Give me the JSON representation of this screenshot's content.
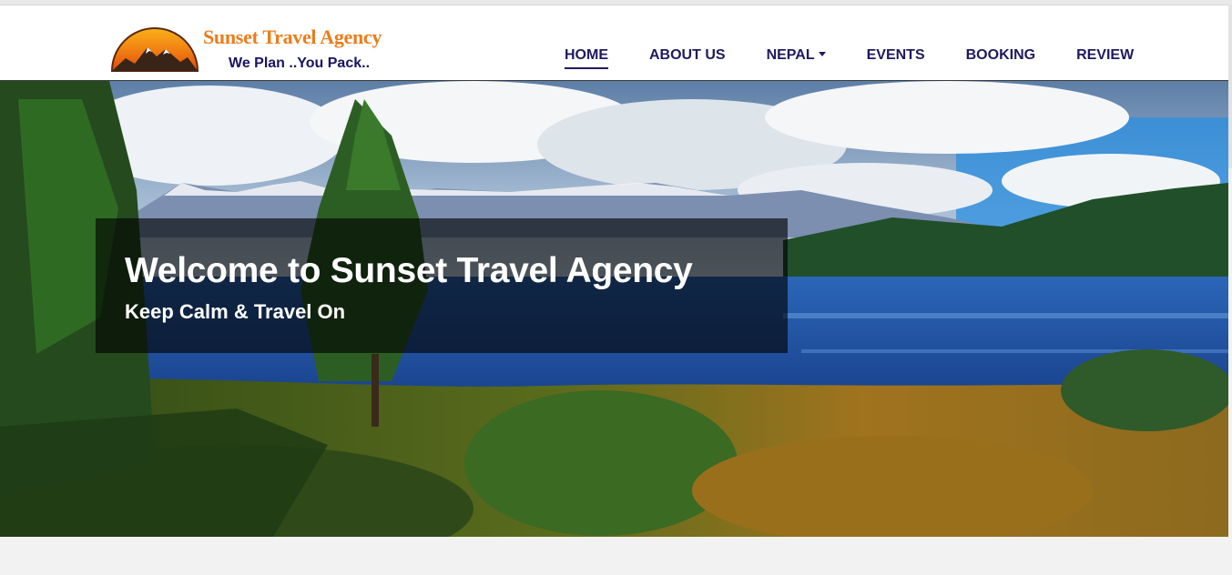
{
  "brand": {
    "name": "Sunset Travel Agency",
    "tagline": "We Plan ..You Pack..",
    "logo_icon": "sunset-mountain-logo",
    "colors": {
      "name": "#ea7d1b",
      "tagline": "#1a1460"
    }
  },
  "nav": {
    "items": [
      {
        "label": "HOME",
        "active": true
      },
      {
        "label": "ABOUT US",
        "active": false
      },
      {
        "label": "NEPAL",
        "active": false,
        "dropdown": true
      },
      {
        "label": "EVENTS",
        "active": false
      },
      {
        "label": "BOOKING",
        "active": false
      },
      {
        "label": "REVIEW",
        "active": false
      }
    ],
    "color": "#1f1a5e"
  },
  "hero": {
    "title": "Welcome to Sunset Travel Agency",
    "subtitle": "Keep Calm & Travel On",
    "image": "lake-with-mountains-and-forest"
  }
}
